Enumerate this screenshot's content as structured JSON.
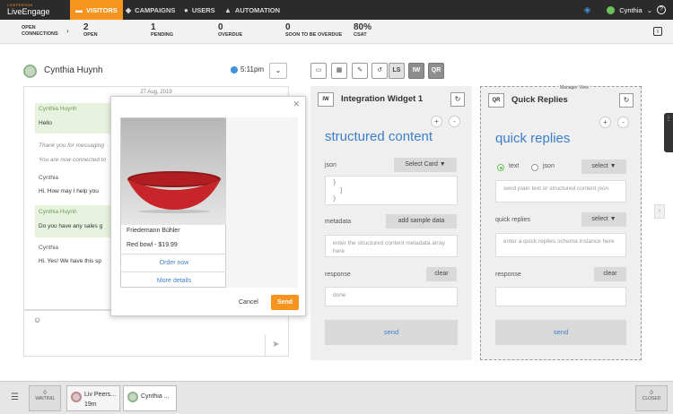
{
  "nav": {
    "logo_small": "LIVEPERSON",
    "logo_big": "LiveEngage",
    "tabs": [
      {
        "label": "VISITORS",
        "icon": "chat-bubble-icon"
      },
      {
        "label": "CAMPAIGNS",
        "icon": "tag-icon"
      },
      {
        "label": "USERS",
        "icon": "user-icon"
      },
      {
        "label": "AUTOMATION",
        "icon": "robot-icon"
      }
    ],
    "user": "Cynthia",
    "colors": {
      "bar": "#2b2b2b",
      "active": "#f7941d",
      "online": "#6ac259"
    }
  },
  "stats": {
    "open_connections": "OPEN\nCONNECTIONS",
    "items": [
      {
        "num": "2",
        "label": "OPEN"
      },
      {
        "num": "1",
        "label": "PENDING"
      },
      {
        "num": "0",
        "label": "OVERDUE"
      },
      {
        "num": "0",
        "label": "SOON TO BE OVERDUE"
      },
      {
        "num": "80%",
        "label": "CSAT"
      }
    ]
  },
  "chat": {
    "name": "Cynthia Huynh",
    "time": "5:11pm",
    "date": "27 Aug, 2019",
    "messages": [
      {
        "sender": "Cynthia Huynh",
        "text": "Hello"
      },
      {
        "text": "Thank you for messaging"
      },
      {
        "text": "You are now connected to"
      },
      {
        "sender": "Cynthia",
        "text": "Hi. How may I help you"
      },
      {
        "sender": "Cynthia Huynh",
        "text": "Do you have any sales g"
      },
      {
        "sender": "Cynthia",
        "text": "Hi. Yes! We have this sp"
      }
    ]
  },
  "modal": {
    "card_title": "Friedemann Bühler",
    "card_sub": "Red bowl - $19.99",
    "btn1": "Order now",
    "btn2": "More details",
    "cancel": "Cancel",
    "send": "Send"
  },
  "toolbar": {
    "ls": "LS",
    "iw": "IW",
    "qr": "QR"
  },
  "iw": {
    "title": "Integration Widget 1",
    "icon_text": "IW",
    "heading": "structured content",
    "json_label": "json",
    "select_card": "Select Card ▼",
    "json_code": "}\n  ]\n}",
    "metadata_label": "metadata",
    "add_sample": "add sample data",
    "metadata_placeholder": "enter the structured content metadata array here",
    "response_label": "response",
    "clear": "clear",
    "done": "done",
    "send": "send"
  },
  "qr": {
    "title": "Quick Replies",
    "icon_text": "QR",
    "manager_view": "Manager View",
    "heading": "quick replies",
    "radio_text": "text",
    "radio_json": "json",
    "select": "select ▼",
    "text_placeholder": "send plain text or structured content json",
    "qr_label": "quick replies",
    "qr_select": "select ▼",
    "qr_placeholder": "enter a quick replies schema instance here",
    "response_label": "response",
    "clear": "clear",
    "send": "send"
  },
  "bottom": {
    "waiting_num": "0",
    "waiting": "WAITING",
    "tab1_name": "Liv Peers...",
    "tab1_time": "19m",
    "tab2_name": "Cynthia ...",
    "closed_num": "0",
    "closed": "CLOSED"
  }
}
